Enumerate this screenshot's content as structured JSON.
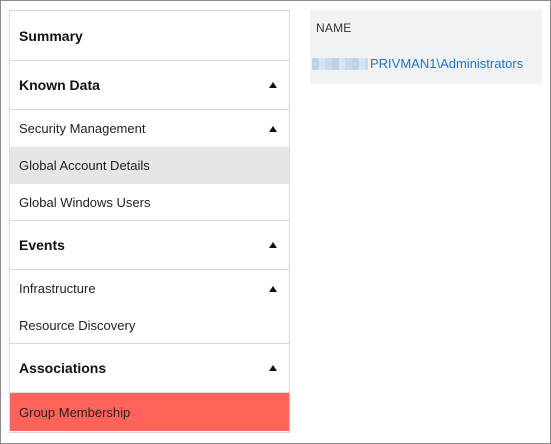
{
  "sidebar": {
    "summary_label": "Summary",
    "sections": [
      {
        "label": "Known Data",
        "items": [
          {
            "label": "Security Management",
            "expanded": true
          },
          {
            "label": "Global Account Details",
            "state": "selected"
          },
          {
            "label": "Global Windows Users"
          }
        ]
      },
      {
        "label": "Events",
        "items": [
          {
            "label": "Infrastructure",
            "expanded": true
          },
          {
            "label": "Resource Discovery"
          }
        ]
      },
      {
        "label": "Associations",
        "items": [
          {
            "label": "Group Membership",
            "state": "active"
          }
        ]
      }
    ],
    "caret_icon": "caret-up-icon"
  },
  "results": {
    "column_header": "NAME",
    "rows": [
      {
        "name": "PRIVMAN1\\Administrators",
        "prefix_redacted": true
      }
    ]
  },
  "colors": {
    "active_item_bg": "#ff6259",
    "selected_item_bg": "#e6e6e6",
    "link": "#1d77c7",
    "results_bg": "#f1f2f3"
  }
}
